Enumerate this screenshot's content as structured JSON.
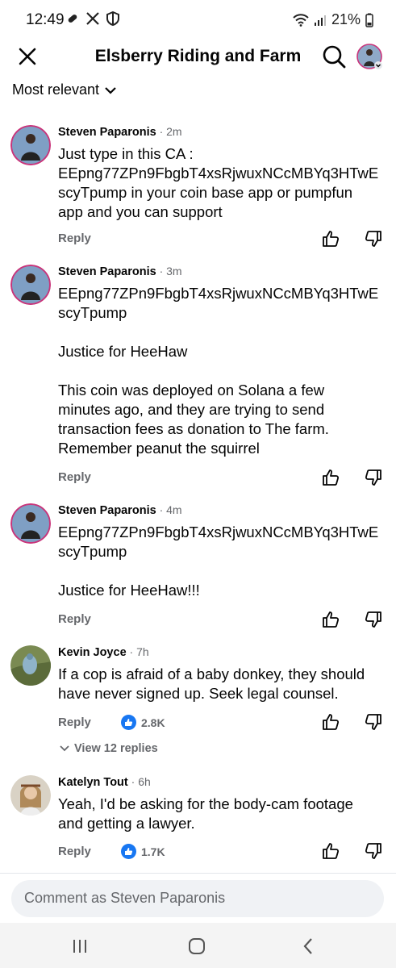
{
  "status_bar": {
    "time": "12:49",
    "battery": "21%"
  },
  "header": {
    "title": "Elsberry Riding and Farm"
  },
  "sort": {
    "label": "Most relevant"
  },
  "comments": [
    {
      "name": "Steven Paparonis",
      "time": "2m",
      "lines": [
        "Just type in this CA :",
        "EEpng77ZPn9FbgbT4xsRjwuxNCcMBYq3HTwE",
        "scyTpump in your coin base app or pumpfun",
        "app and you can support"
      ],
      "reply_label": "Reply"
    },
    {
      "name": "Steven Paparonis",
      "time": "3m",
      "lines": [
        "EEpng77ZPn9FbgbT4xsRjwuxNCcMBYq3HTwE",
        "scyTpump",
        "",
        "Justice for HeeHaw",
        "",
        "This coin was deployed on Solana a few",
        "minutes ago, and they are trying to send",
        "transaction fees as donation to The farm.",
        "Remember peanut the squirrel"
      ],
      "reply_label": "Reply"
    },
    {
      "name": "Steven Paparonis",
      "time": "4m",
      "lines": [
        "EEpng77ZPn9FbgbT4xsRjwuxNCcMBYq3HTwE",
        "scyTpump",
        "",
        "Justice for HeeHaw!!!"
      ],
      "reply_label": "Reply"
    },
    {
      "name": "Kevin Joyce",
      "time": "7h",
      "lines": [
        "If a cop is afraid of a baby donkey, they should",
        "have never signed up. Seek legal counsel."
      ],
      "reply_label": "Reply",
      "likes": "2.8K",
      "view_replies": "View 12 replies"
    },
    {
      "name": "Katelyn Tout",
      "time": "6h",
      "lines": [
        "Yeah, I'd be asking for the body-cam footage",
        "and getting a lawyer."
      ],
      "reply_label": "Reply",
      "likes": "1.7K"
    }
  ],
  "composer": {
    "placeholder": "Comment as Steven Paparonis"
  },
  "icons": {
    "close": "close-icon",
    "search": "search-icon",
    "like": "thumbs-up-icon",
    "dislike": "thumbs-down-icon",
    "like_badge": "like-reaction-icon"
  },
  "colors": {
    "accent": "#1877f2",
    "secondary_text": "#65676b"
  }
}
